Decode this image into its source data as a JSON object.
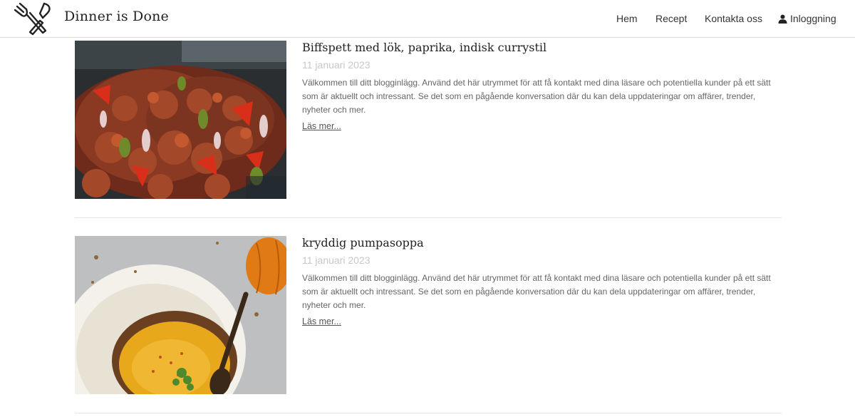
{
  "header": {
    "site_title": "Dinner is Done",
    "logo_icon": "fork-knife-icon",
    "nav": {
      "home": "Hem",
      "recipes": "Recept",
      "contact": "Kontakta oss",
      "login": "Inloggning",
      "login_icon": "user-icon"
    }
  },
  "posts": [
    {
      "title": "Biffspett med lök, paprika, indisk currystil",
      "date": "11 januari 2023",
      "excerpt": "Välkommen till ditt blogginlägg. Använd det här utrymmet för att få kontakt med dina läsare och potentiella kunder på ett sätt som är aktuellt och intressant. Se det som en pågående konversation där du kan dela uppdateringar om affärer, trender, nyheter och mer.",
      "read_more": "Läs mer..."
    },
    {
      "title": "kryddig pumpasoppa",
      "date": "11 januari 2023",
      "excerpt": "Välkommen till ditt blogginlägg. Använd det här utrymmet för att få kontakt med dina läsare och potentiella kunder på ett sätt som är aktuellt och intressant. Se det som en pågående konversation där du kan dela uppdateringar om affärer, trender, nyheter och mer.",
      "read_more": "Läs mer..."
    }
  ]
}
